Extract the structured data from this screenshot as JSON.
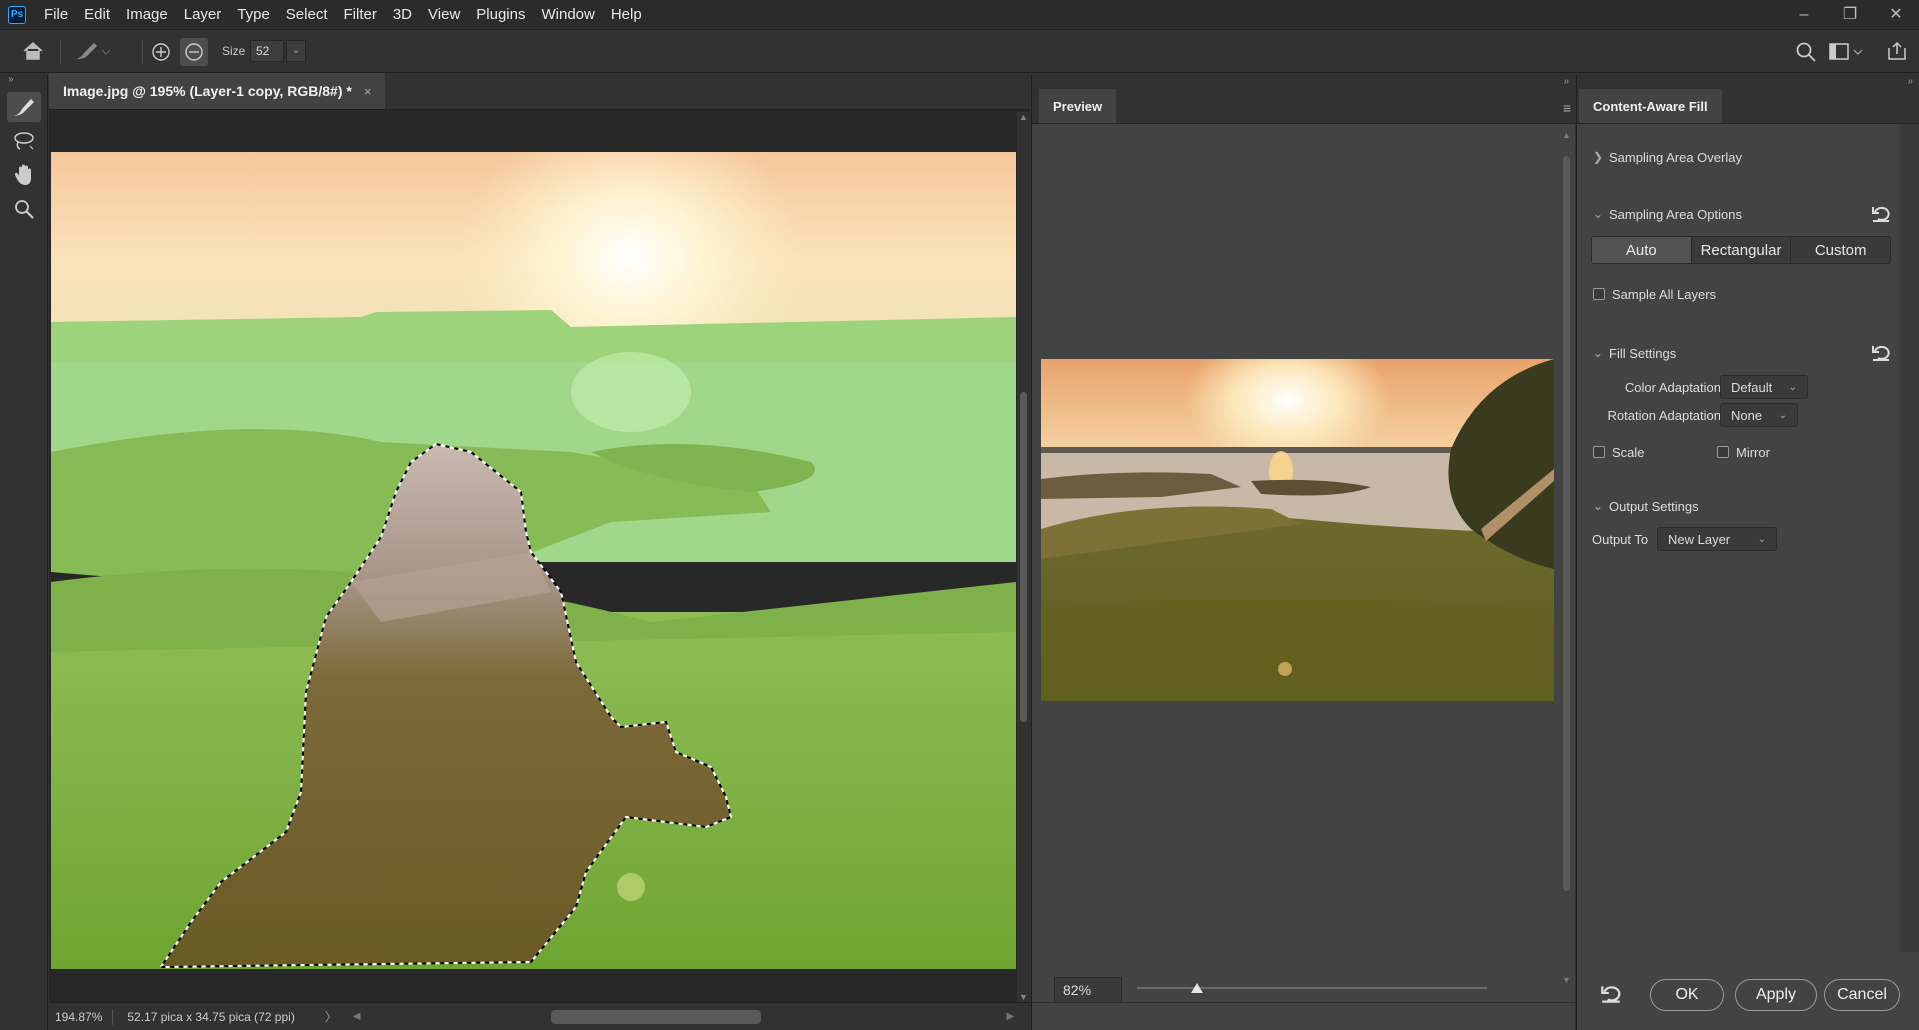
{
  "menu": [
    "File",
    "Edit",
    "Image",
    "Layer",
    "Type",
    "Select",
    "Filter",
    "3D",
    "View",
    "Plugins",
    "Window",
    "Help"
  ],
  "app_logo": "Ps",
  "options_bar": {
    "size_label": "Size",
    "size_value": "52"
  },
  "document": {
    "tab_title": "Image.jpg @ 195% (Layer-1 copy, RGB/8#) *",
    "close_glyph": "×",
    "zoom_status": "194.87%",
    "dimensions_status": "52.17 pica x 34.75 pica (72 ppi)"
  },
  "preview_panel": {
    "tab_label": "Preview",
    "zoom_value": "82%",
    "zoom_fraction": 0.17
  },
  "caf_panel": {
    "tab_label": "Content-Aware Fill",
    "sampling_overlay_label": "Sampling Area Overlay",
    "sampling_options_label": "Sampling Area Options",
    "sampling_modes": [
      "Auto",
      "Rectangular",
      "Custom"
    ],
    "sampling_mode_selected": "Auto",
    "sample_all_layers_label": "Sample All Layers",
    "fill_settings_label": "Fill Settings",
    "color_adaptation_label": "Color Adaptation",
    "color_adaptation_value": "Default",
    "rotation_adaptation_label": "Rotation Adaptation",
    "rotation_adaptation_value": "None",
    "scale_label": "Scale",
    "mirror_label": "Mirror",
    "output_settings_label": "Output Settings",
    "output_to_label": "Output To",
    "output_to_value": "New Layer",
    "ok_label": "OK",
    "apply_label": "Apply",
    "cancel_label": "Cancel"
  },
  "colors": {
    "ui_dark": "#323232",
    "panel": "#434343",
    "accent_ps": "#31a8ff",
    "mask_green": "#8fd66e"
  }
}
